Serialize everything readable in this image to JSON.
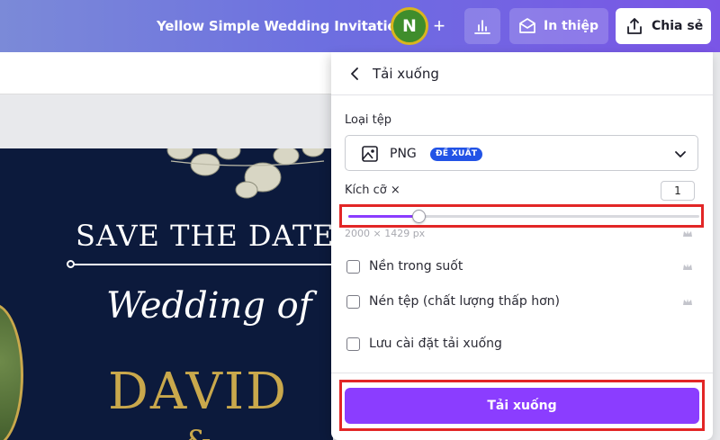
{
  "topbar": {
    "doc_title": "Yellow Simple Wedding Invitation",
    "avatar_initial": "N",
    "plus_label": "+",
    "print_label": "In thiệp",
    "share_label": "Chia sẻ"
  },
  "design": {
    "save_the_date": "SAVE THE DATE",
    "wedding_of": "Wedding of",
    "name_first": "DAVID",
    "ampersand": "&"
  },
  "panel": {
    "title": "Tải xuống",
    "file_type_label": "Loại tệp",
    "file_type_value": "PNG",
    "recommended_badge": "ĐỀ XUẤT",
    "size_label": "Kích cỡ ×",
    "size_value": "1",
    "size_slider_fraction": 0.2,
    "dimensions": "2000 × 1429 px",
    "options": [
      {
        "label": "Nền trong suốt",
        "checked": false,
        "premium": true
      },
      {
        "label": "Nén tệp (chất lượng thấp hơn)",
        "checked": false,
        "premium": true
      },
      {
        "label": "Lưu cài đặt tải xuống",
        "checked": false,
        "premium": false
      }
    ],
    "download_label": "Tải xuống"
  },
  "colors": {
    "accent": "#8b3dff",
    "badge": "#2253e6",
    "highlight": "#e22626",
    "design_bg": "#0c1a3c",
    "gold": "#c9a84c"
  }
}
